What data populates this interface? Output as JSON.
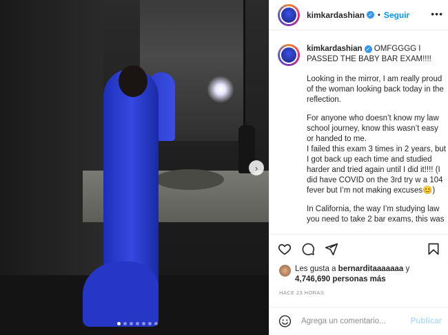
{
  "post": {
    "username": "kimkardashian",
    "follow_label": "Seguir",
    "more_icon": "more-icon",
    "caption_headline": "OMFGGGG I PASSED THE BABY BAR EXAM!!!!",
    "caption_paragraphs": [
      "Looking in the mirror, I am really proud of the woman looking back today in the reflection.",
      "For anyone who doesn’t know my law school journey, know this wasn’t easy or handed to me.",
      "I failed this exam 3 times in 2 years, but I got back up each time and studied harder and tried again until I did it!!!! (I did have COVID on the 3rd try w a 104 fever but I’m not making excuses😊)",
      "In California, the way I’m studying law you need to take 2 bar exams, this was"
    ],
    "likes_prefix": "Les gusta a",
    "liked_by": "bernarditaaaaaaa",
    "likes_join": "y",
    "likes_count": "4,746,690 personas más",
    "timestamp": "HACE 23 HORAS",
    "comment_placeholder": "Agrega un comentario...",
    "publish_label": "Publicar"
  },
  "carousel": {
    "dots": 7,
    "active_index": 0
  },
  "colors": {
    "link_blue": "#0095f6",
    "verified_blue": "#3897f0",
    "publish_disabled": "#b2dffc",
    "dress_blue": "#2637c8"
  }
}
